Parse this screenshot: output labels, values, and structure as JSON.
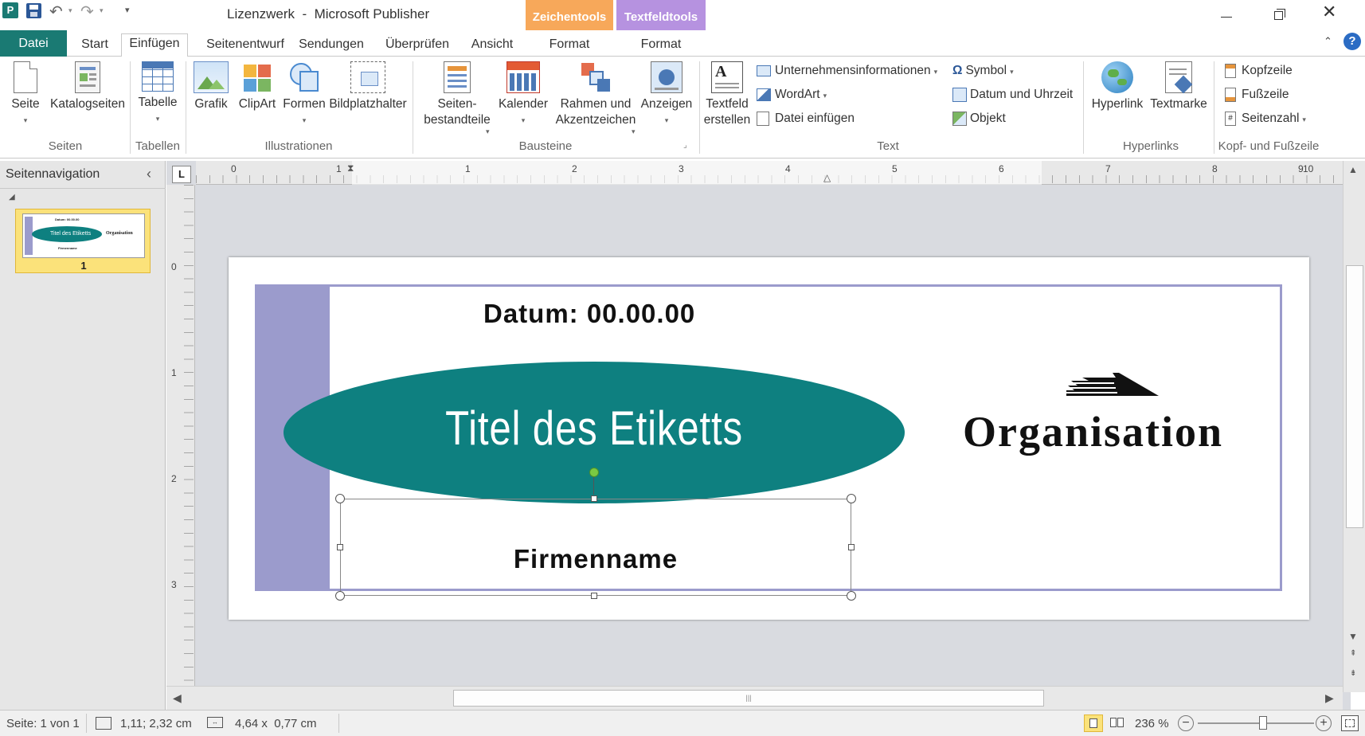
{
  "app": {
    "title": "Lizenzwerk  -  Microsoft Publisher",
    "quick_access": [
      "save-icon",
      "undo-icon",
      "redo-icon",
      "customize-icon"
    ]
  },
  "context_tabs": [
    {
      "header": "Zeichentools",
      "tab": "Format",
      "color": "#f7a85a"
    },
    {
      "header": "Textfeldtools",
      "tab": "Format",
      "color": "#b692e0"
    }
  ],
  "tabs": [
    "Datei",
    "Start",
    "Einfügen",
    "Seitenentwurf",
    "Sendungen",
    "Überprüfen",
    "Ansicht"
  ],
  "active_tab": "Einfügen",
  "ribbon": {
    "groups": [
      {
        "label": "Seiten",
        "buttons": [
          "Seite",
          "Katalogseiten"
        ]
      },
      {
        "label": "Tabellen",
        "buttons": [
          "Tabelle"
        ]
      },
      {
        "label": "Illustrationen",
        "buttons": [
          "Grafik",
          "ClipArt",
          "Formen",
          "Bildplatzhalter"
        ]
      },
      {
        "label": "Bausteine",
        "buttons": [
          "Seiten-\nbestandteile",
          "Kalender",
          "Rahmen und\nAkzentzeichen",
          "Anzeigen"
        ]
      },
      {
        "label": "Text",
        "buttons": [
          "Textfeld\nerstellen"
        ],
        "small": [
          "Unternehmensinformationen",
          "WordArt",
          "Datei einfügen",
          "Symbol",
          "Datum und Uhrzeit",
          "Objekt"
        ]
      },
      {
        "label": "Hyperlinks",
        "buttons": [
          "Hyperlink",
          "Textmarke"
        ]
      },
      {
        "label": "Kopf- und Fußzeile",
        "small": [
          "Kopfzeile",
          "Fußzeile",
          "Seitenzahl"
        ]
      }
    ]
  },
  "nav": {
    "title": "Seitennavigation",
    "page_number": "1",
    "thumb": {
      "date": "Datum: 00.00.00",
      "title": "Titel des Etiketts",
      "org": "Organisation",
      "company": "Firmenname"
    }
  },
  "ruler": {
    "h": [
      "0",
      "1",
      "1",
      "2",
      "3",
      "4",
      "5",
      "6",
      "7",
      "8",
      "9",
      "10"
    ],
    "v": [
      "0",
      "1",
      "2",
      "3"
    ],
    "corner": "L"
  },
  "document": {
    "date": "Datum: 00.00.00",
    "title": "Titel des Etiketts",
    "org": "Organisation",
    "company": "Firmenname",
    "colors": {
      "accent_bar": "#9b9bcc",
      "ellipse": "#0e8080",
      "border": "#9b9bcc"
    }
  },
  "status": {
    "page": "Seite: 1 von 1",
    "position": "1,11; 2,32 cm",
    "size": "4,64 x  0,77 cm",
    "zoom": "236 %",
    "zoom_level": 0.56
  }
}
